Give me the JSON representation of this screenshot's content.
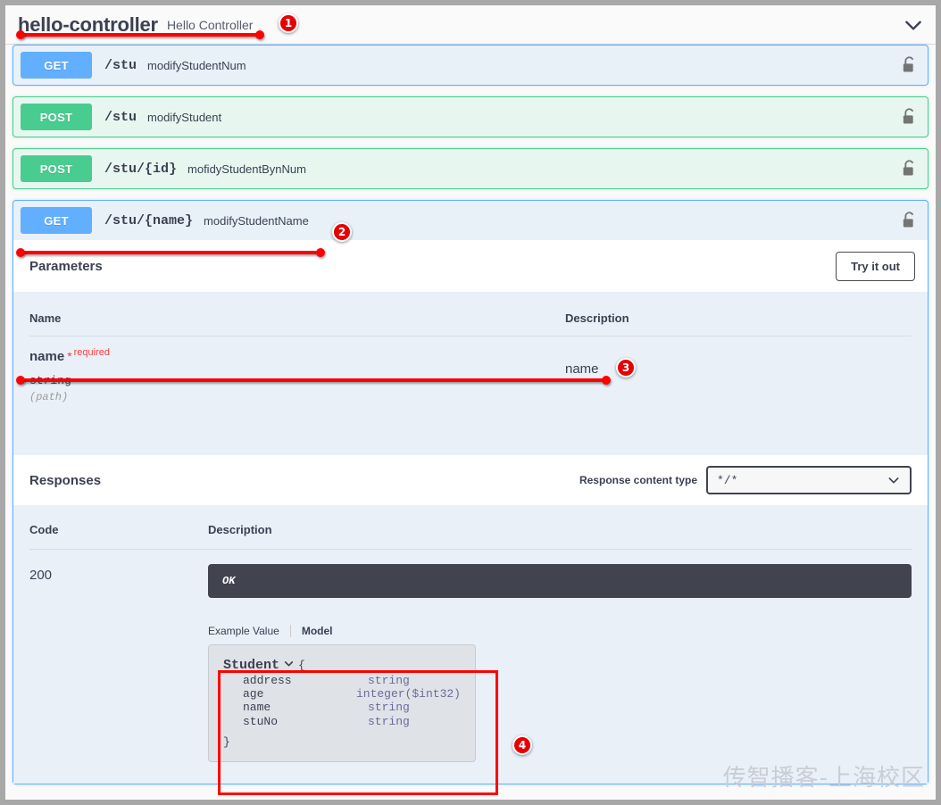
{
  "tag": {
    "name": "hello-controller",
    "description": "Hello Controller",
    "collapse_icon": "chevron-down-icon"
  },
  "operations": [
    {
      "method": "GET",
      "path": "/stu",
      "summary": "modifyStudentNum",
      "lock_icon": "unlocked-padlock-icon"
    },
    {
      "method": "POST",
      "path": "/stu",
      "summary": "modifyStudent",
      "lock_icon": "unlocked-padlock-icon"
    },
    {
      "method": "POST",
      "path": "/stu/{id}",
      "summary": "mofidyStudentBynNum",
      "lock_icon": "unlocked-padlock-icon"
    },
    {
      "method": "GET",
      "path": "/stu/{name}",
      "summary": "modifyStudentName",
      "lock_icon": "unlocked-padlock-icon"
    }
  ],
  "expanded": {
    "parameters": {
      "title": "Parameters",
      "try_it_out_label": "Try it out",
      "columns": {
        "name": "Name",
        "description": "Description"
      },
      "rows": [
        {
          "name": "name",
          "required_star": "*",
          "required_label": "required",
          "type": "string",
          "in": "(path)",
          "description": "name"
        }
      ]
    },
    "responses": {
      "title": "Responses",
      "content_type_label": "Response content type",
      "content_type_value": "*/*",
      "content_type_chevron": "chevron-down-icon",
      "columns": {
        "code": "Code",
        "description": "Description"
      },
      "rows": [
        {
          "code": "200",
          "description": "OK",
          "tabs": {
            "example": "Example Value",
            "model": "Model"
          },
          "model": {
            "name": "Student",
            "toggle_icon": "chevron-down-icon",
            "open_brace": "{",
            "close_brace": "}",
            "properties": [
              {
                "prop": "address",
                "type": "string"
              },
              {
                "prop": "age",
                "type": "integer($int32)"
              },
              {
                "prop": "name",
                "type": "string"
              },
              {
                "prop": "stuNo",
                "type": "string"
              }
            ]
          }
        }
      ]
    }
  },
  "annotations": {
    "badges": [
      {
        "label": "1"
      },
      {
        "label": "2"
      },
      {
        "label": "3"
      },
      {
        "label": "4"
      }
    ],
    "color": "#ff0000"
  },
  "watermark": "传智播客-上海校区",
  "colors": {
    "get": "#61affe",
    "post": "#49cc90",
    "required": "#f93e3e",
    "dark_panel": "#41444e",
    "annotation_red": "#ff0000"
  }
}
